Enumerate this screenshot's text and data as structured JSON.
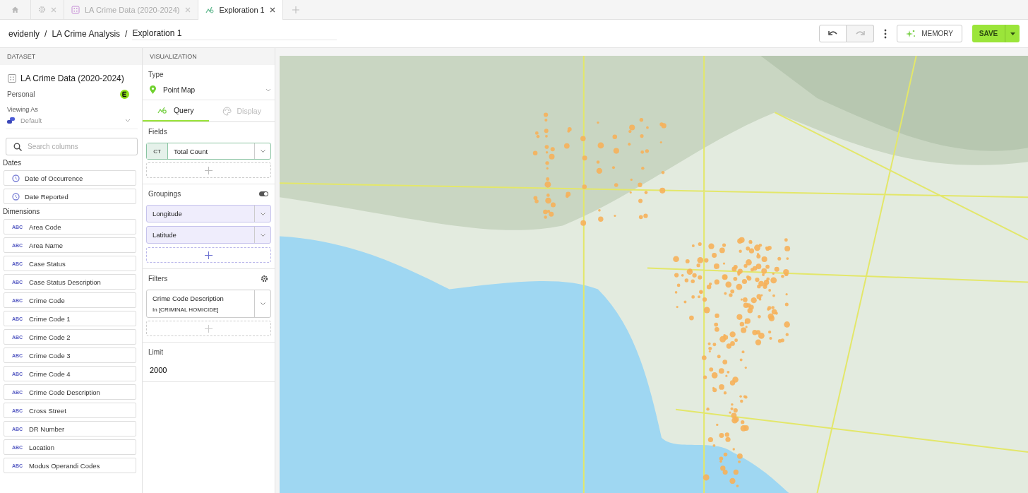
{
  "tabs": [
    {
      "kind": "home",
      "selected": false
    },
    {
      "kind": "settings",
      "selected": false
    },
    {
      "kind": "dataset",
      "label": "LA Crime Data (2020-2024)",
      "selected": false
    },
    {
      "kind": "exploration",
      "label": "Exploration 1",
      "selected": true
    }
  ],
  "breadcrumb": {
    "items": [
      "evidenly",
      "LA Crime Analysis"
    ],
    "separator": "/",
    "title": "Exploration 1"
  },
  "toolbar": {
    "memory_label": "MEMORY",
    "save_label": "SAVE"
  },
  "dataset": {
    "header": "DATASET",
    "title": "LA Crime Data (2020-2024)",
    "owner": "Personal",
    "viewing_as_label": "Viewing As",
    "viewing_as": "Default",
    "search_placeholder": "Search columns",
    "sections": [
      {
        "title": "Dates",
        "columns": [
          {
            "name": "Date of Occurrence",
            "kind": "date"
          },
          {
            "name": "Date Reported",
            "kind": "date"
          }
        ]
      },
      {
        "title": "Dimensions",
        "columns": [
          {
            "name": "Area Code",
            "kind": "text",
            "badge": "ABC"
          },
          {
            "name": "Area Name",
            "kind": "text",
            "badge": "ABC"
          },
          {
            "name": "Case Status",
            "kind": "text",
            "badge": "ABC"
          },
          {
            "name": "Case Status Description",
            "kind": "text",
            "badge": "ABC"
          },
          {
            "name": "Crime Code",
            "kind": "text",
            "badge": "ABC"
          },
          {
            "name": "Crime Code 1",
            "kind": "text",
            "badge": "ABC"
          },
          {
            "name": "Crime Code 2",
            "kind": "text",
            "badge": "ABC"
          },
          {
            "name": "Crime Code 3",
            "kind": "text",
            "badge": "ABC"
          },
          {
            "name": "Crime Code 4",
            "kind": "text",
            "badge": "ABC"
          },
          {
            "name": "Crime Code Description",
            "kind": "text",
            "badge": "ABC"
          },
          {
            "name": "Cross Street",
            "kind": "text",
            "badge": "ABC"
          },
          {
            "name": "DR Number",
            "kind": "text",
            "badge": "ABC"
          },
          {
            "name": "Location",
            "kind": "text",
            "badge": "ABC"
          },
          {
            "name": "Modus Operandi Codes",
            "kind": "text",
            "badge": "ABC"
          }
        ]
      }
    ]
  },
  "visualization": {
    "header": "VISUALIZATION",
    "type_label": "Type",
    "type": "Point Map",
    "subtabs": [
      {
        "label": "Query",
        "kind": "query",
        "selected": true
      },
      {
        "label": "Display",
        "kind": "display",
        "selected": false
      }
    ],
    "fields_label": "Fields",
    "fields": [
      {
        "badge": "CT",
        "name": "Total Count"
      }
    ],
    "groupings_label": "Groupings",
    "groupings_on": true,
    "groupings": [
      "Longitude",
      "Latitude"
    ],
    "filters_label": "Filters",
    "filters": [
      {
        "name": "Crime Code Description",
        "condition": "In [CRIMINAL HOMICIDE]"
      }
    ],
    "limit_label": "Limit",
    "limit": "2000"
  }
}
